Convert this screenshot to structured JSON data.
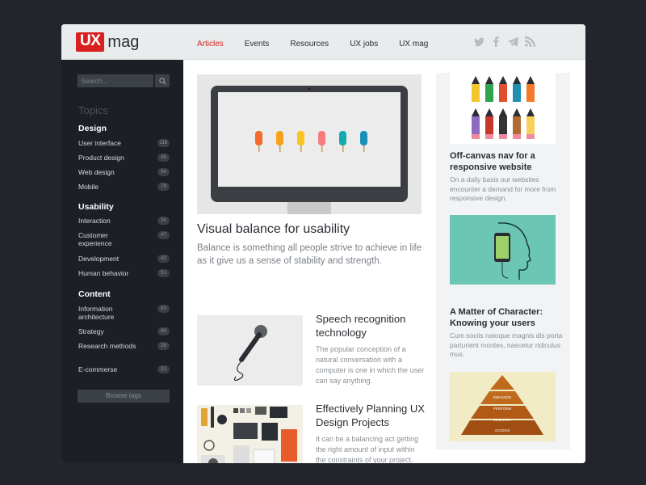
{
  "logo": {
    "ux": "UX",
    "mag": "mag"
  },
  "nav": [
    {
      "label": "Articles"
    },
    {
      "label": "Events"
    },
    {
      "label": "Resources"
    },
    {
      "label": "UX jobs"
    },
    {
      "label": "UX mag"
    }
  ],
  "social": [
    "twitter-icon",
    "facebook-icon",
    "telegram-icon",
    "rss-icon"
  ],
  "sidebar": {
    "search_placeholder": "Search...",
    "topics_title": "Topics",
    "categories": [
      {
        "title": "Design",
        "items": [
          {
            "label": "User interface",
            "count": "118"
          },
          {
            "label": "Product design",
            "count": "45"
          },
          {
            "label": "Web design",
            "count": "94"
          },
          {
            "label": "Mobile",
            "count": "79"
          }
        ]
      },
      {
        "title": "Usability",
        "items": [
          {
            "label": "Interaction",
            "count": "34"
          },
          {
            "label": "Customer experience",
            "count": "47"
          },
          {
            "label": "Development",
            "count": "42"
          },
          {
            "label": "Human behavior",
            "count": "51"
          }
        ]
      },
      {
        "title": "Content",
        "items": [
          {
            "label": "Information architecture",
            "count": "63"
          },
          {
            "label": "Strategy",
            "count": "80"
          },
          {
            "label": "Research methods",
            "count": "28"
          },
          {
            "label": "E-commerse",
            "count": "31"
          }
        ]
      }
    ],
    "browse_label": "Browse tags"
  },
  "featured": {
    "title": "Visual balance for usability",
    "description": "Balance is something all people strive to achieve in life as it give us a sense of stability and strength."
  },
  "articles": [
    {
      "title": "Speech recognition technology",
      "description": "The popular conception of a natural conversation with a computer is one in which the user can say anything."
    },
    {
      "title": "Effectively Planning UX Design Projects",
      "description": "It can be a balancing act getting the right amount of input within the constraints of your project."
    }
  ],
  "sidecards": [
    {
      "title": "Off-canvas nav for a responsive website",
      "description": "On a daily basis our websites encounter a demand for more from responsive design."
    },
    {
      "title": "A Matter of Character: Knowing your users",
      "description": "Cum sociis natoque magnis dis porta parturient montes, nascetur ridiculus mus."
    },
    {
      "pyramid": [
        "ENHANCE",
        "PERFORM",
        "INTERACT",
        "ACCESS"
      ]
    }
  ],
  "colors": {
    "accent": "#d92121",
    "sidebar": "#1c1f25",
    "background": "#22252c"
  }
}
